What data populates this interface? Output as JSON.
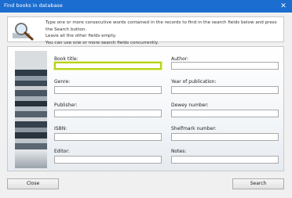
{
  "window": {
    "title": "Find books in database"
  },
  "info": {
    "line1": "Type one or more consecutive words contained in the records to find in the search fields below and press the Search button.",
    "line2": "Leave all the other fields empty.",
    "line3": "You can use one or more search fields concurrently."
  },
  "fields": {
    "book_title": {
      "label": "Book title:",
      "value": ""
    },
    "genre": {
      "label": "Genre:",
      "value": ""
    },
    "publisher": {
      "label": "Publisher:",
      "value": ""
    },
    "isbn": {
      "label": "ISBN:",
      "value": ""
    },
    "editor": {
      "label": "Editor:",
      "value": ""
    },
    "author": {
      "label": "Author:",
      "value": ""
    },
    "year": {
      "label": "Year of publication:",
      "value": ""
    },
    "dewey": {
      "label": "Dewey number:",
      "value": ""
    },
    "shelfmark": {
      "label": "Shelfmark number:",
      "value": ""
    },
    "notes": {
      "label": "Notes:",
      "value": ""
    }
  },
  "buttons": {
    "close": "Close",
    "search": "Search"
  },
  "icons": {
    "info": "magnifier-icon",
    "close": "close-icon",
    "decor": "books-image"
  }
}
